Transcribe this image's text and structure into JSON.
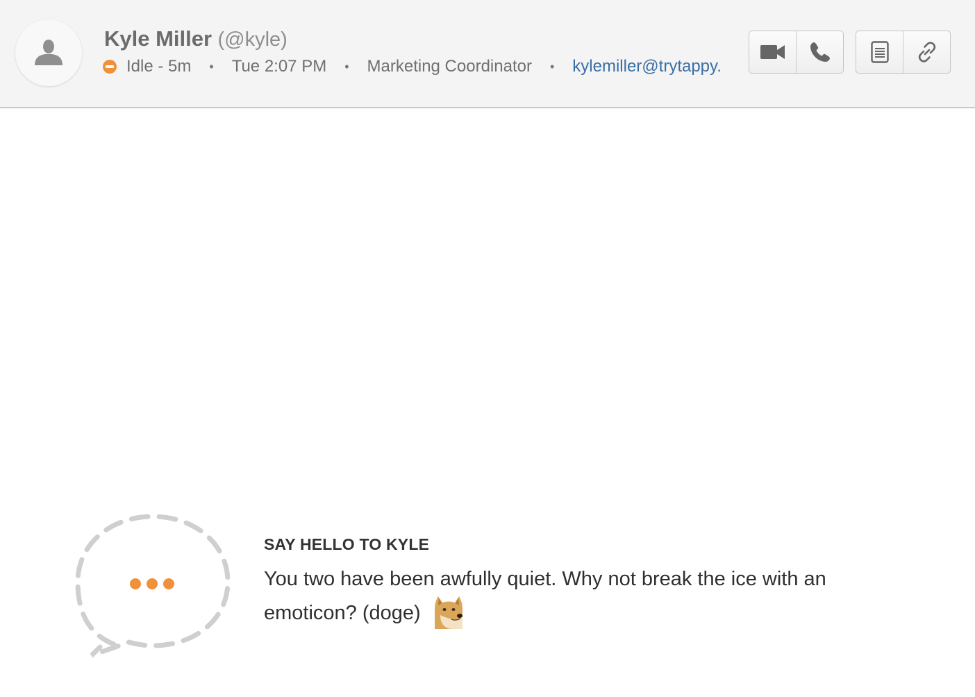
{
  "header": {
    "avatar_icon": "user-silhouette-icon",
    "name": "Kyle Miller",
    "handle": "(@kyle)",
    "status_icon": "idle-status-icon",
    "status_color": "#f0913a",
    "status": "Idle - 5m",
    "local_time": "Tue 2:07 PM",
    "title": "Marketing Coordinator",
    "email": "kylemiller@trytappy.",
    "separator": "•",
    "buttons": {
      "video_icon": "video-camera-icon",
      "phone_icon": "phone-icon",
      "notes_icon": "document-icon",
      "link_icon": "link-icon"
    }
  },
  "empty_state": {
    "bubble_icon": "chat-bubble-icon",
    "title": "SAY HELLO TO KYLE",
    "message": "You two have been awfully quiet. Why not break the ice with an emoticon? (doge)",
    "emoticon_icon": "doge-emoticon-icon",
    "accent_color": "#f0913a"
  }
}
